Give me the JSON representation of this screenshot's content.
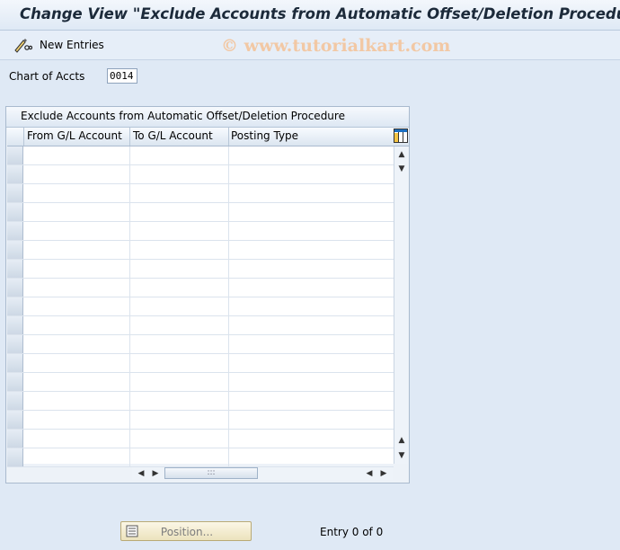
{
  "window": {
    "title": "Change View \"Exclude Accounts from Automatic Offset/Deletion Procedure"
  },
  "toolbar": {
    "new_entries_label": "New Entries"
  },
  "watermark": {
    "text": "© www.tutorialkart.com"
  },
  "filter": {
    "chart_of_accts_label": "Chart of Accts",
    "chart_of_accts_value": "0014"
  },
  "table": {
    "title": "Exclude Accounts from Automatic Offset/Deletion Procedure",
    "columns": [
      "From G/L Account",
      "To G/L Account",
      "Posting Type"
    ],
    "visible_rows": 17
  },
  "footer": {
    "position_label": "Position...",
    "entry_text": "Entry 0 of 0"
  },
  "colors": {
    "background": "#dfe9f5",
    "title_text": "#1c2a3a",
    "watermark": "#f2c8a4",
    "button_face": "#ece3bd"
  },
  "icons": {
    "new_entries": "pencil-glasses-icon",
    "table_settings": "table-config-icon",
    "position": "position-icon"
  }
}
